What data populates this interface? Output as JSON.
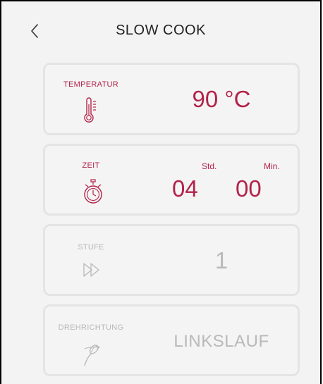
{
  "header": {
    "title": "SLOW COOK",
    "back_icon": "chevron-left-icon"
  },
  "temperature": {
    "label": "TEMPERATUR",
    "value": "90 °C",
    "icon": "thermometer-icon"
  },
  "time": {
    "label": "ZEIT",
    "hours": "04",
    "hours_unit": "Std.",
    "minutes": "00",
    "minutes_unit": "Min.",
    "icon": "stopwatch-icon"
  },
  "level": {
    "label": "STUFE",
    "value": "1",
    "icon": "fast-forward-icon"
  },
  "direction": {
    "label": "DREHRICHTUNG",
    "value": "LINKSLAUF",
    "icon": "whisk-icon"
  },
  "colors": {
    "accent": "#b3224a",
    "inactive": "#b9b9b9",
    "background": "#f3f3f3",
    "card_border": "#e4e4e4"
  }
}
